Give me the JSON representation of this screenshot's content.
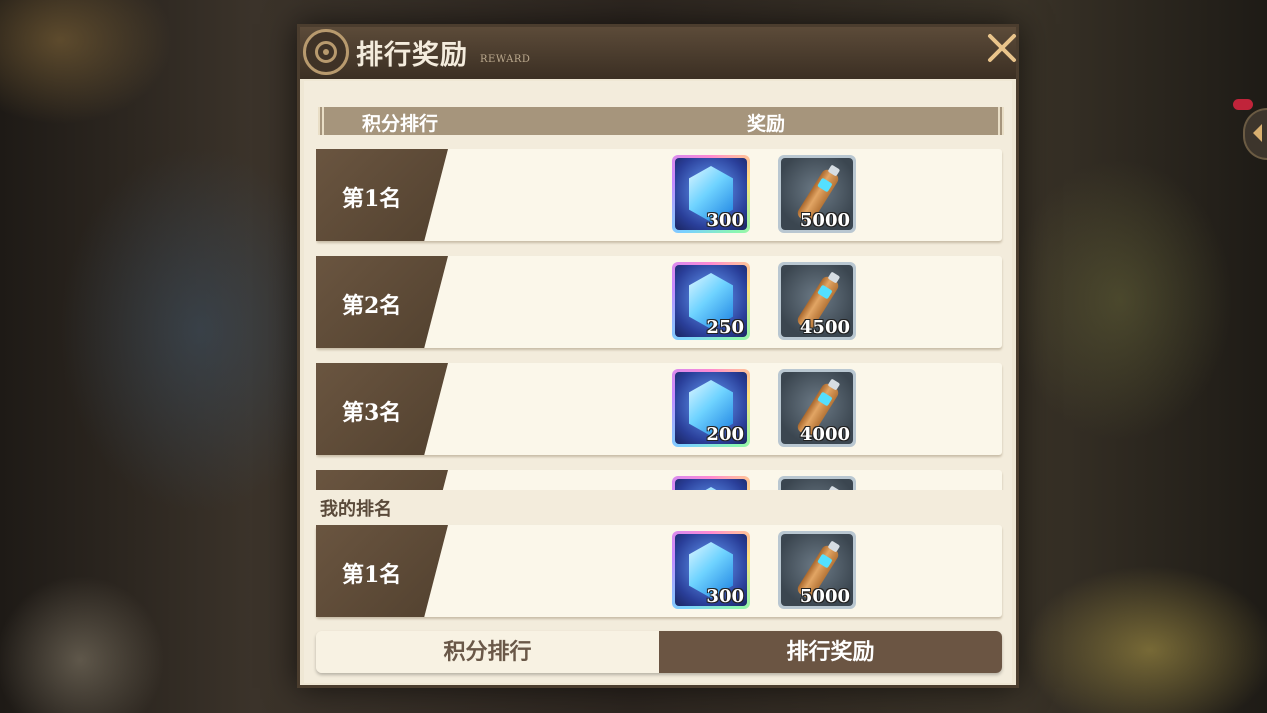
{
  "dialog": {
    "title": "排行奖励",
    "subtitle": "REWARD"
  },
  "table": {
    "col_rank": "积分排行",
    "col_reward": "奖励"
  },
  "rows": [
    {
      "rank": "第1名",
      "gem_qty": "300",
      "flask_qty": "5000"
    },
    {
      "rank": "第2名",
      "gem_qty": "250",
      "flask_qty": "4500"
    },
    {
      "rank": "第3名",
      "gem_qty": "200",
      "flask_qty": "4000"
    }
  ],
  "my_rank": {
    "label": "我的排名",
    "rank": "第1名",
    "gem_qty": "300",
    "flask_qty": "5000"
  },
  "tabs": [
    {
      "label": "积分排行",
      "active": false
    },
    {
      "label": "排行奖励",
      "active": true
    }
  ],
  "icons": {
    "reward_gem": "blue-crystal-icon",
    "reward_flask": "potion-flask-icon",
    "close": "close-icon",
    "emblem": "gear-emblem-icon"
  },
  "colors": {
    "accent_dark": "#6b5543",
    "panel": "#f3ecdc",
    "header": "#a6957c"
  }
}
